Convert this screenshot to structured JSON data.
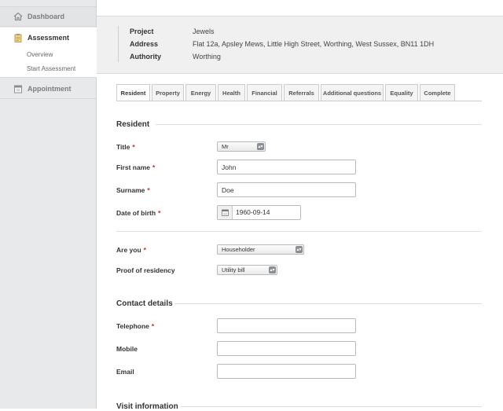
{
  "sidebar": {
    "dashboard": "Dashboard",
    "assessment": "Assessment",
    "overview": "Overview",
    "start_assessment": "Start Assessment",
    "appointment": "Appointment"
  },
  "header": {
    "project_label": "Project",
    "project_value": "Jewels",
    "address_label": "Address",
    "address_value": "Flat 12a, Apsley Mews, Little High Street, Worthing, West Sussex, BN11 1DH",
    "authority_label": "Authority",
    "authority_value": "Worthing"
  },
  "tabs": [
    "Resident",
    "Property",
    "Energy",
    "Health",
    "Financial",
    "Referrals",
    "Additional questions",
    "Equality",
    "Complete"
  ],
  "form": {
    "resident_title": "Resident",
    "title_label": "Title",
    "title_value": "Mr",
    "first_name_label": "First name",
    "first_name_value": "John",
    "surname_label": "Surname",
    "surname_value": "Doe",
    "dob_label": "Date of birth",
    "dob_value": "1960-09-14",
    "are_you_label": "Are you",
    "are_you_value": "Householder",
    "proof_label": "Proof of residency",
    "proof_value": "Utility bill",
    "contact_title": "Contact details",
    "telephone_label": "Telephone",
    "telephone_value": "",
    "mobile_label": "Mobile",
    "mobile_value": "",
    "email_label": "Email",
    "email_value": "",
    "visit_title": "Visit information",
    "required_marker": "*"
  },
  "colors": {
    "required": "#d0222a",
    "sidebar_bg": "#e8e9eb"
  }
}
